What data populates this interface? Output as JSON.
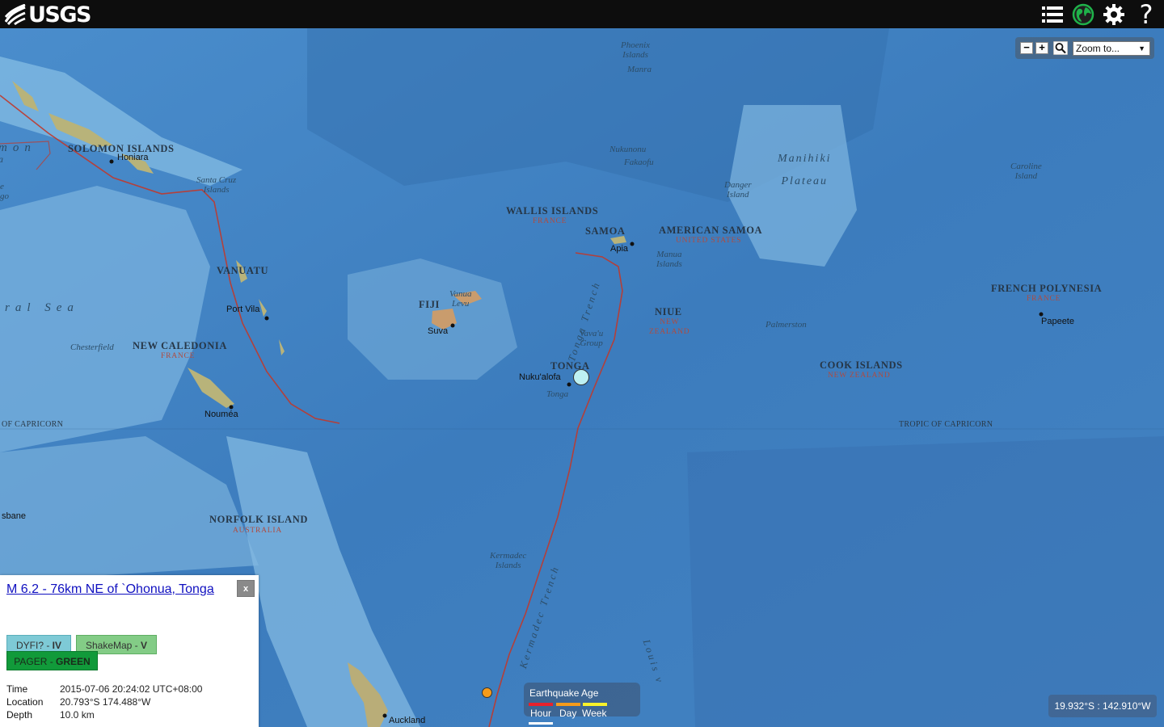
{
  "header": {
    "logo_text": "USGS",
    "icons": [
      "list-icon",
      "globe-icon",
      "gear-icon",
      "help-icon"
    ],
    "help_glyph": "?"
  },
  "zoom": {
    "zoom_out": "−",
    "zoom_in": "+",
    "select_value": "Zoom to...",
    "select_arrow": "▼"
  },
  "map": {
    "labels": {
      "solomon": "SOLOMON ISLANDS",
      "honiara": "Honiara",
      "santa_cruz": "Santa Cruz\nIslands",
      "vanuatu": "VANUATU",
      "port_vila": "Port Vila",
      "new_caledonia": "NEW CALEDONIA",
      "new_caledonia_sov": "FRANCE",
      "chesterfield": "Chesterfield",
      "noumea": "Nouméa",
      "fiji": "FIJI",
      "vanua_levu": "Vanua\nLevu",
      "suva": "Suva",
      "wallis": "WALLIS ISLANDS",
      "wallis_sov": "FRANCE",
      "samoa": "SAMOA",
      "apia": "Apia",
      "american_samoa": "AMERICAN SAMOA",
      "american_samoa_sov": "UNITED STATES",
      "manua": "Manua\nIslands",
      "niue": "NIUE",
      "niue_sov": "NEW\nZEALAND",
      "tonga": "TONGA",
      "nukualofa": "Nuku'alofa",
      "tonga_feature": "Tonga",
      "vavau": "Vava'u\nGroup",
      "tonga_trench": "Tonga Trench",
      "phoenix": "Phoenix\nIslands",
      "manra": "Manra",
      "nukunonu": "Nukunonu",
      "fakaofu": "Fakaofu",
      "danger": "Danger\nIsland",
      "manihiki": "Manihiki\nPlateau",
      "caroline": "Caroline\nIsland",
      "french_polynesia": "FRENCH POLYNESIA",
      "french_polynesia_sov": "FRANCE",
      "papeete": "Papeete",
      "palmerston": "Palmerston",
      "cook": "COOK ISLANDS",
      "cook_sov": "NEW ZEALAND",
      "tropic_left": "OF CAPRICORN",
      "tropic_right": "TROPIC OF CAPRICORN",
      "norfolk": "NORFOLK ISLAND",
      "norfolk_sov": "AUSTRALIA",
      "kermadec": "Kermadec\nIslands",
      "kermadec_trench": "Kermadec Trench",
      "louisville": "Louis v",
      "auckland": "Auckland",
      "brisbane": "sbane",
      "coral_sea": "ral  Sea",
      "solomon_sea_a": "mon",
      "solomon_sea_b": "a",
      "edge_e": "e",
      "edge_go": "go"
    }
  },
  "popup": {
    "title": "M 6.2 - 76km NE of `Ohonua, Tonga",
    "close": "x",
    "dyfi_label": "DYFI? - ",
    "dyfi_value": "IV",
    "shakemap_label": "ShakeMap - ",
    "shakemap_value": "V",
    "pager_label": "PAGER - ",
    "pager_value": "GREEN",
    "props": [
      {
        "name": "Time",
        "value": "2015-07-06 20:24:02 UTC+08:00"
      },
      {
        "name": "Location",
        "value": "20.793°S 174.488°W"
      },
      {
        "name": "Depth",
        "value": "10.0 km"
      }
    ]
  },
  "legend": {
    "title": "Earthquake Age",
    "items": [
      {
        "label": "Hour",
        "color": "#e8212b"
      },
      {
        "label": "Day",
        "color": "#f59b1a"
      },
      {
        "label": "Week",
        "color": "#f7f22a"
      }
    ],
    "month_color": "#ffffff"
  },
  "coords": {
    "text": "19.932°S : 142.910°W"
  },
  "colors": {
    "ocean": "#3f7fbf",
    "shelf": "#8cc0e4",
    "plate_boundary": "#c0392b",
    "selected_quake": "#bdf0f2",
    "other_quake": "#f59b1a"
  }
}
